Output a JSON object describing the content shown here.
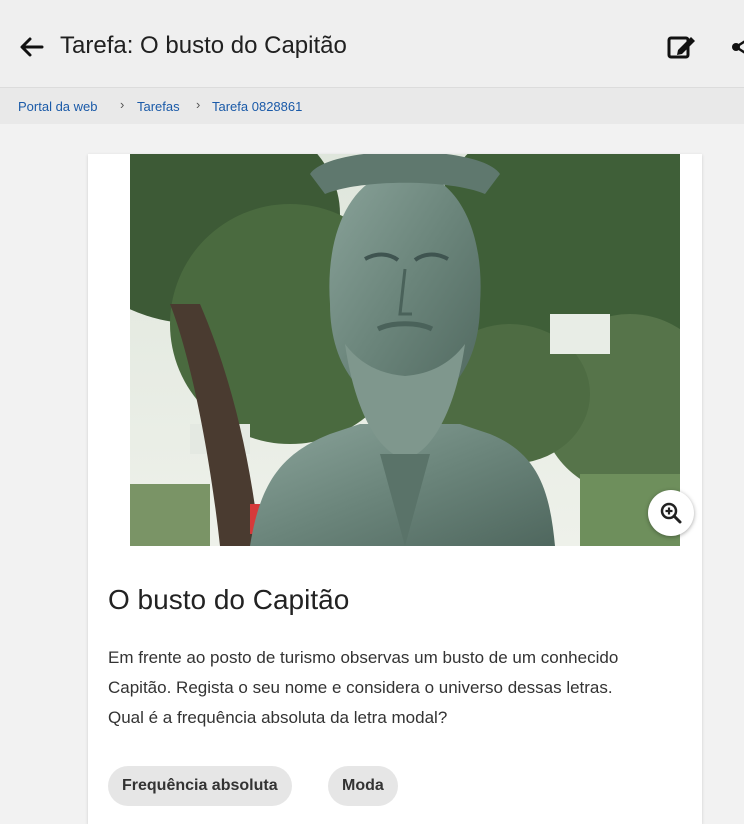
{
  "header": {
    "back_icon": "arrow-left-icon",
    "title": "Tarefa: O busto do Capitão",
    "edit_icon": "edit-note-icon",
    "share_icon": "share-icon"
  },
  "breadcrumb": {
    "items": [
      "Portal da web",
      "Tarefas",
      "Tarefa 0828861"
    ],
    "separator": "›"
  },
  "task": {
    "image_alt": "Busto de bronze de um capitão barbudo",
    "zoom_icon": "zoom-in-icon",
    "title": "O busto do Capitão",
    "description_lines": [
      "Em frente ao posto de turismo observas um busto de um conhecido",
      "Capitão. Regista o seu nome e considera o universo dessas letras.",
      "Qual é a frequência absoluta da letra modal?"
    ],
    "tags": [
      "Frequência absoluta",
      "Moda"
    ]
  },
  "colors": {
    "link": "#1a5aa8",
    "background": "#f2f2f2",
    "bronze": "#6f8a80"
  }
}
